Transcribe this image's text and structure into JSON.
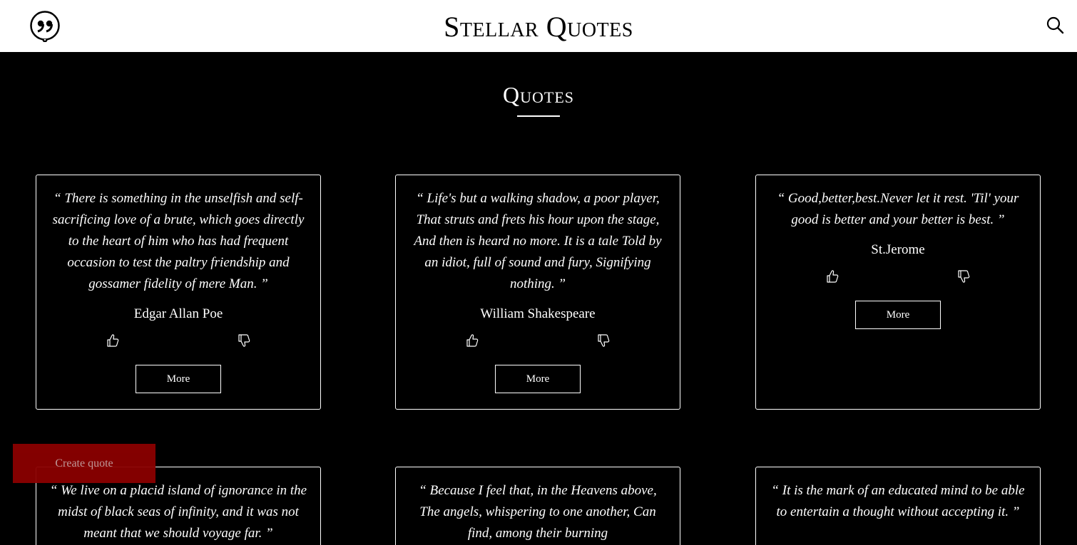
{
  "header": {
    "brand": "Stellar Quotes",
    "logo_icon": "quote-bubble-icon",
    "search_icon": "search-icon"
  },
  "main": {
    "title": "Quotes"
  },
  "cards": [
    {
      "quote": "“ There is something in the unselfish and self-sacrificing love of a brute, which goes directly to the heart of him who has had frequent occasion to test the paltry friendship and gossamer fidelity of mere Man. ”",
      "author": "Edgar Allan Poe",
      "more_label": "More"
    },
    {
      "quote": "“ Life's but a walking shadow, a poor player, That struts and frets his hour upon the stage, And then is heard no more. It is a tale Told by an idiot, full of sound and fury, Signifying nothing. ”",
      "author": "William Shakespeare",
      "more_label": "More"
    },
    {
      "quote": "“ Good,better,best.Never let it rest. 'Til' your good is better and your better is best. ”",
      "author": "St.Jerome",
      "more_label": "More"
    },
    {
      "quote": "“ We live on a placid island of ignorance in the midst of black seas of infinity, and it was not meant that we should voyage far. ”"
    },
    {
      "quote": "“ Because I feel that, in the Heavens above, The angels, whispering to one another, Can find, among their burning"
    },
    {
      "quote": "“ It is the mark of an educated mind to be able to entertain a thought without accepting it. ”"
    }
  ],
  "create_button": "Create quote",
  "colors": {
    "header_bg": "#ffffff",
    "page_bg": "#000000",
    "create_button_bg": "#8b0000"
  }
}
